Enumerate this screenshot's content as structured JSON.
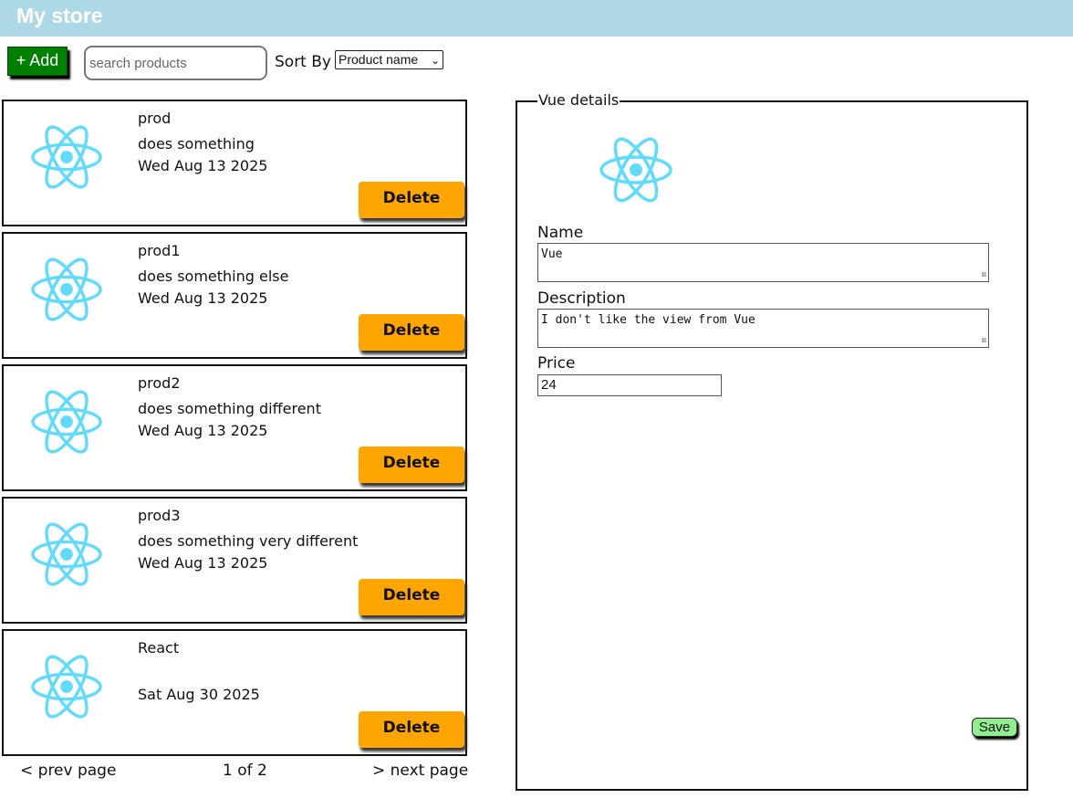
{
  "app": {
    "title": "My store"
  },
  "toolbar": {
    "add_label": "+ Add",
    "search_placeholder": "search products",
    "sort_label": "Sort By",
    "sort_selected": "Product name"
  },
  "products": [
    {
      "name": "prod",
      "description": "does something",
      "date": "Wed Aug 13 2025",
      "delete_label": "Delete"
    },
    {
      "name": "prod1",
      "description": "does something else",
      "date": "Wed Aug 13 2025",
      "delete_label": "Delete"
    },
    {
      "name": "prod2",
      "description": "does something different",
      "date": "Wed Aug 13 2025",
      "delete_label": "Delete"
    },
    {
      "name": "prod3",
      "description": "does something very different",
      "date": "Wed Aug 13 2025",
      "delete_label": "Delete"
    },
    {
      "name": "React",
      "description": "",
      "date": "Sat Aug 30 2025",
      "delete_label": "Delete"
    }
  ],
  "pagination": {
    "prev": "< prev page",
    "status": "1 of 2",
    "next": "> next page"
  },
  "details": {
    "legend": "Vue details",
    "name_label": "Name",
    "name_value": "Vue",
    "description_label": "Description",
    "description_value": "I don't like the view from Vue",
    "price_label": "Price",
    "price_value": "24",
    "save_label": "Save"
  },
  "icons": {
    "product": "react-atom-icon"
  },
  "colors": {
    "header_bg": "#add8e6",
    "add_button": "#008000",
    "delete_button": "#ffa500",
    "save_button": "#90ee90",
    "atom_icon": "#61dafb"
  }
}
